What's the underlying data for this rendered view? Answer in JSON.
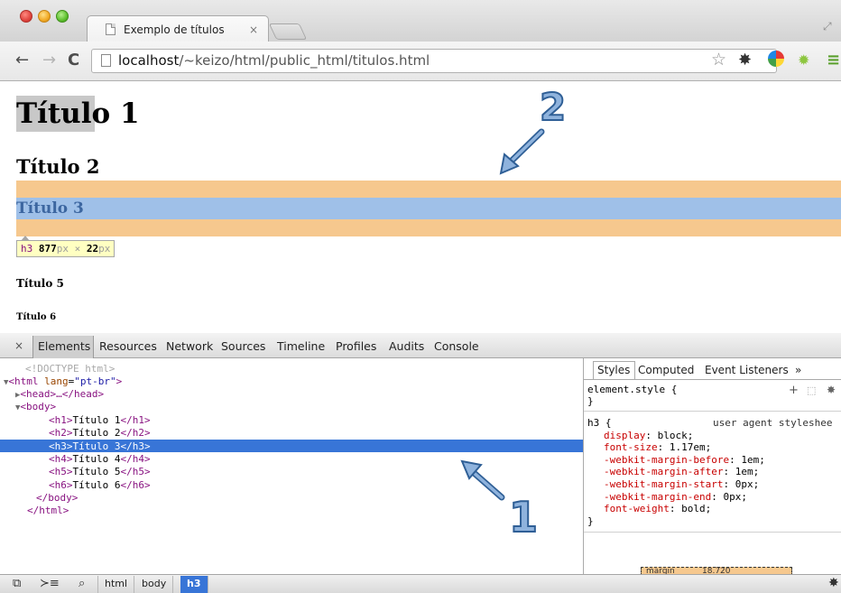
{
  "browser": {
    "tab_title": "Exemplo de títulos",
    "tab_close": "×",
    "url_host": "localhost",
    "url_path": "/~keizo/html/public_html/titulos.html"
  },
  "icons": {
    "back": "←",
    "forward": "→",
    "reload": "C",
    "star": "☆",
    "extension_gear": "✸",
    "android": "✹",
    "menu": "≡"
  },
  "page": {
    "h1": "Título 1",
    "h2": "Título 2",
    "h3": "Título 3",
    "h5": "Título 5",
    "h6": "Título 6",
    "tooltip": {
      "tag": "h3",
      "width": "877",
      "width_unit": "px",
      "times": "×",
      "height": "22",
      "height_unit": "px"
    },
    "highlight_colors": {
      "margin": "#f6c88e",
      "content": "#9fc0e8",
      "text": "#3c66a0"
    }
  },
  "annotations": {
    "label_1": "1",
    "label_2": "2"
  },
  "devtools": {
    "close": "×",
    "tabs": [
      "Elements",
      "Resources",
      "Network",
      "Sources",
      "Timeline",
      "Profiles",
      "Audits",
      "Console"
    ],
    "dom": [
      {
        "text": "<!DOCTYPE html>"
      },
      {
        "open": "<html ",
        "attr": "lang",
        "eq": "=",
        "val": "\"pt-br\"",
        "close": ">"
      },
      {
        "text": "<head>…</head>"
      },
      {
        "text": "<body>"
      },
      {
        "tag_open": "<h1>",
        "inner": "Título 1",
        "tag_close": "</h1>"
      },
      {
        "tag_open": "<h2>",
        "inner": "Título 2",
        "tag_close": "</h2>"
      },
      {
        "tag_open": "<h3>",
        "inner": "Título 3",
        "tag_close": "</h3>"
      },
      {
        "tag_open": "<h4>",
        "inner": "Título 4",
        "tag_close": "</h4>"
      },
      {
        "tag_open": "<h5>",
        "inner": "Título 5",
        "tag_close": "</h5>"
      },
      {
        "tag_open": "<h6>",
        "inner": "Título 6",
        "tag_close": "</h6>"
      },
      {
        "text": "</body>"
      },
      {
        "text": "</html>"
      }
    ],
    "styles_tabs": [
      "Styles",
      "Computed",
      "Event Listeners",
      "»"
    ],
    "element_style": "element.style {",
    "close_brace": "}",
    "rule_selector": "h3 {",
    "rule_origin": "user agent styleshee",
    "declarations": [
      {
        "prop": "display",
        "value": ": block;"
      },
      {
        "prop": "font-size",
        "value": ": 1.17em;"
      },
      {
        "prop": "-webkit-margin-before",
        "value": ": 1em;"
      },
      {
        "prop": "-webkit-margin-after",
        "value": ": 1em;"
      },
      {
        "prop": "-webkit-margin-start",
        "value": ": 0px;"
      },
      {
        "prop": "-webkit-margin-end",
        "value": ": 0px;"
      },
      {
        "prop": "font-weight",
        "value": ": bold;"
      }
    ],
    "metrics_label": "margin",
    "metrics_value": "18.720",
    "breadcrumbs": [
      "html",
      "body",
      "h3"
    ]
  }
}
